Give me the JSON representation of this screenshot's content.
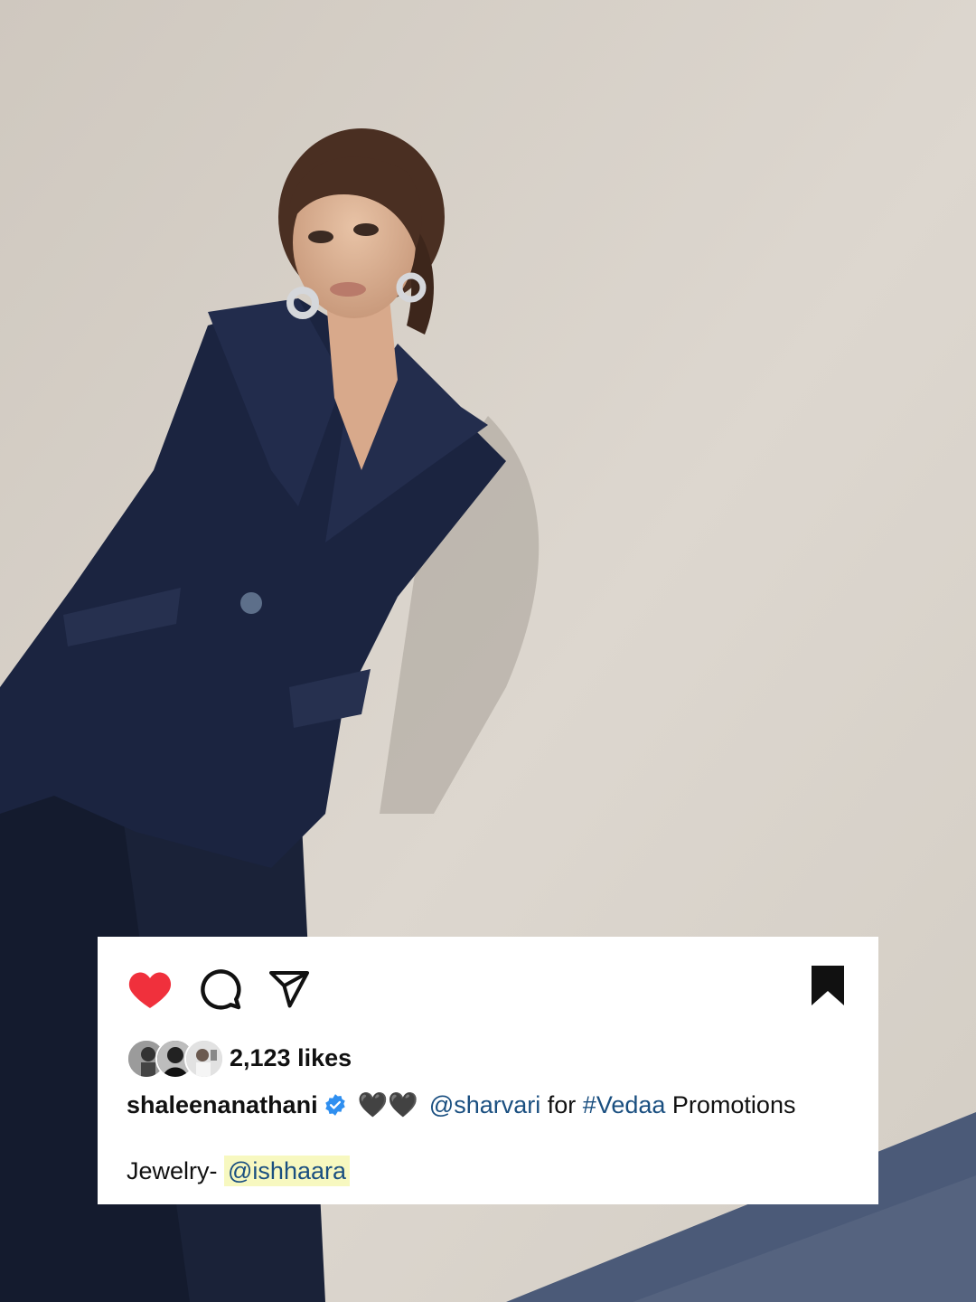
{
  "post": {
    "likes_text": "2,123 likes",
    "username": "shaleenanathani",
    "caption_hearts": "🖤🖤",
    "caption_mention": "@sharvari",
    "caption_for": " for ",
    "caption_hashtag": "#Vedaa",
    "caption_rest": " Promotions",
    "jewelry_label": "Jewelry- ",
    "jewelry_mention": "@ishhaara"
  },
  "icons": {
    "like": "heart-filled-icon",
    "comment": "comment-icon",
    "share": "send-icon",
    "save": "bookmark-filled-icon",
    "verified": "verified-badge-icon"
  },
  "colors": {
    "like": "#f0303c",
    "verified": "#2f8ff0",
    "mention": "#1a4f80",
    "highlight": "#f7f8c0"
  }
}
